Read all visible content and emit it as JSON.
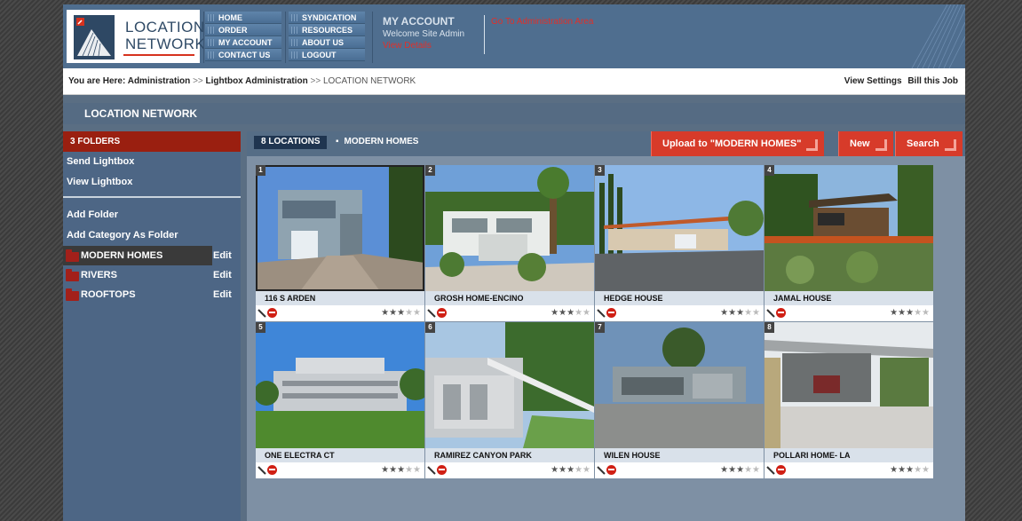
{
  "header": {
    "logo_line1": "LOCATION",
    "logo_line2": "NETWORK",
    "nav_col1": [
      "HOME",
      "ORDER",
      "MY ACCOUNT",
      "CONTACT US"
    ],
    "nav_col2": [
      "SYNDICATION",
      "RESOURCES",
      "ABOUT US",
      "LOGOUT"
    ],
    "account_title": "MY ACCOUNT",
    "welcome": "Welcome Site Admin",
    "view_details": "View Details",
    "admin_link": "Go To Administration Area"
  },
  "breadcrumb": {
    "prefix": "You are Here:",
    "item1": "Administration",
    "sep": ">>",
    "item2": "Lightbox Administration",
    "current": "LOCATION NETWORK",
    "right1": "View Settings",
    "right2": "Bill this Job"
  },
  "title": "LOCATION NETWORK",
  "sidebar": {
    "folders_heading": "3 FOLDERS",
    "send_lightbox": "Send Lightbox",
    "view_lightbox": "View Lightbox",
    "add_folder": "Add Folder",
    "add_category": "Add Category As Folder",
    "edit_label": "Edit",
    "folders": [
      {
        "name": "MODERN HOMES",
        "active": true
      },
      {
        "name": "RIVERS",
        "active": false
      },
      {
        "name": "ROOFTOPS",
        "active": false
      }
    ]
  },
  "main": {
    "count": "8 LOCATIONS",
    "folder": "MODERN HOMES",
    "upload_btn": "Upload to \"MODERN HOMES\"",
    "new_btn": "New",
    "search_btn": "Search"
  },
  "locations": [
    {
      "num": "1",
      "name": "116 S ARDEN",
      "rating": 3
    },
    {
      "num": "2",
      "name": "GROSH HOME-ENCINO",
      "rating": 3
    },
    {
      "num": "3",
      "name": "HEDGE HOUSE",
      "rating": 3
    },
    {
      "num": "4",
      "name": "JAMAL HOUSE",
      "rating": 3
    },
    {
      "num": "5",
      "name": "ONE ELECTRA CT",
      "rating": 3
    },
    {
      "num": "6",
      "name": "RAMIREZ CANYON PARK",
      "rating": 3
    },
    {
      "num": "7",
      "name": "WILEN HOUSE",
      "rating": 3
    },
    {
      "num": "8",
      "name": "POLLARI HOME- LA",
      "rating": 3
    }
  ],
  "colors": {
    "accent_red": "#d73b2a",
    "header_blue": "#4f6e8f",
    "sidebar_blue": "#4d6685"
  }
}
